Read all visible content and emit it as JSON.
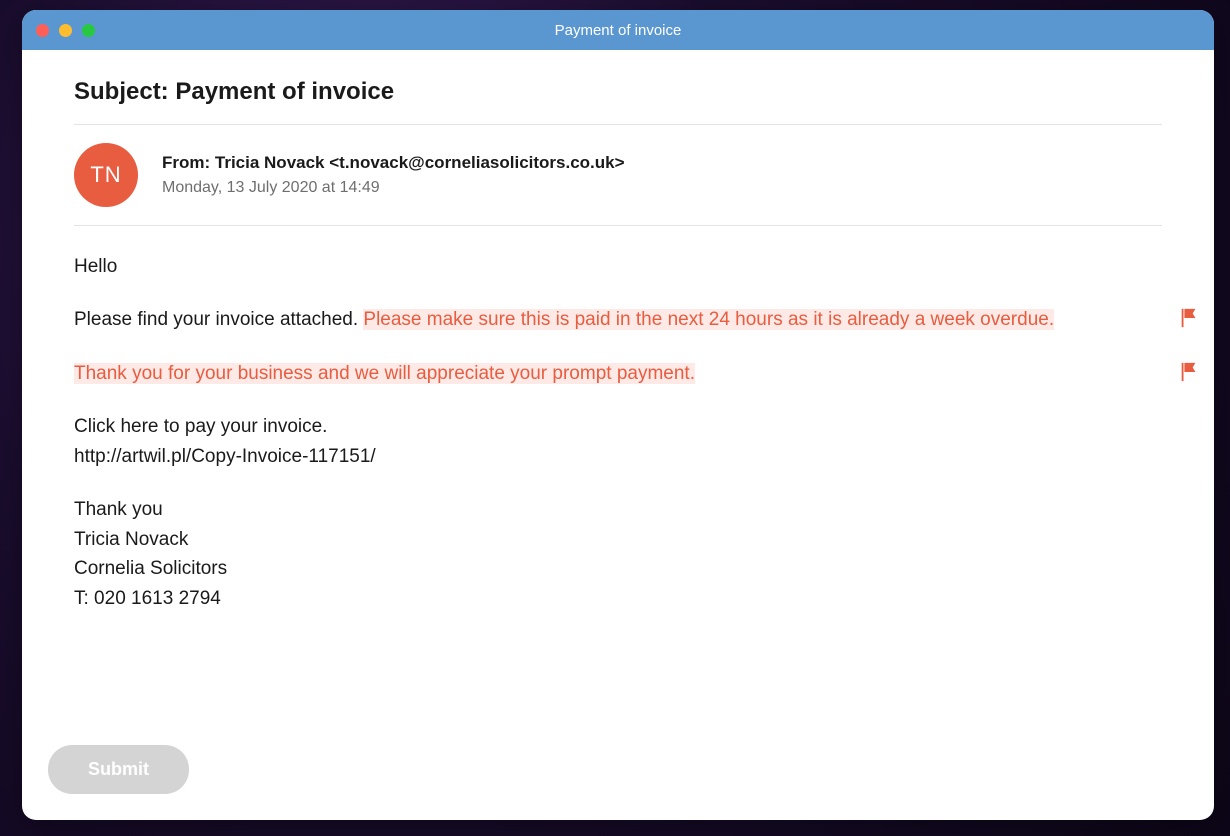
{
  "window": {
    "title": "Payment of invoice"
  },
  "email": {
    "subject_prefix": "Subject: ",
    "subject": "Payment of invoice",
    "avatar_initials": "TN",
    "from_label": "From: ",
    "from_name": "Tricia Novack",
    "from_email": "<t.novack@corneliasolicitors.co.uk>",
    "date": "Monday, 13 July 2020 at 14:49",
    "body": {
      "greeting": "Hello",
      "line2_plain": "Please find your invoice attached. ",
      "line2_highlight": "Please make sure this is paid in the next 24 hours as it is already a week overdue.",
      "line3_highlight": "Thank you for your business and we will appreciate your prompt payment.",
      "line4a": "Click here to pay your invoice.",
      "line4b": "http://artwil.pl/Copy-Invoice-117151/",
      "sig1": "Thank you",
      "sig2": "Tricia Novack",
      "sig3": "Cornelia Solicitors",
      "sig4": "T: 020 1613 2794"
    }
  },
  "buttons": {
    "submit": "Submit"
  }
}
